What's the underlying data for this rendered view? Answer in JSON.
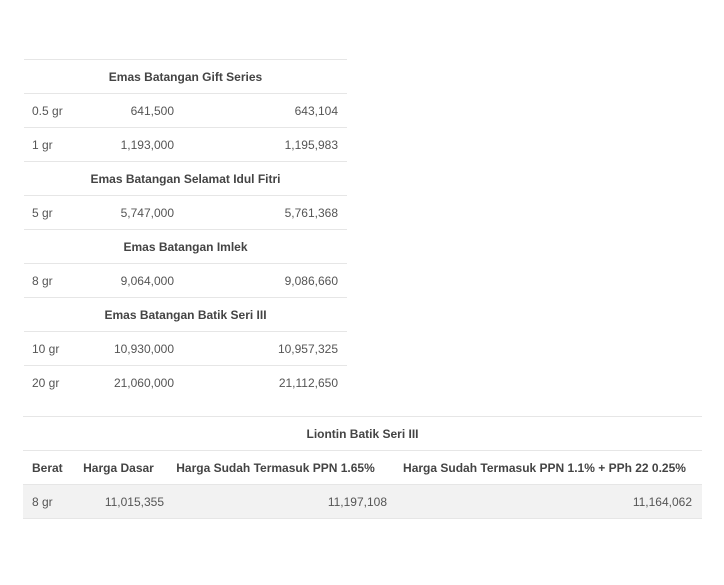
{
  "table1": {
    "sections": [
      {
        "title": "Emas Batangan Gift Series",
        "rows": [
          {
            "berat": "0.5 gr",
            "harga_dasar": "641,500",
            "harga_ppn": "643,104"
          },
          {
            "berat": "1 gr",
            "harga_dasar": "1,193,000",
            "harga_ppn": "1,195,983"
          }
        ]
      },
      {
        "title": "Emas Batangan Selamat Idul Fitri",
        "rows": [
          {
            "berat": "5 gr",
            "harga_dasar": "5,747,000",
            "harga_ppn": "5,761,368"
          }
        ]
      },
      {
        "title": "Emas Batangan Imlek",
        "rows": [
          {
            "berat": "8 gr",
            "harga_dasar": "9,064,000",
            "harga_ppn": "9,086,660"
          }
        ]
      },
      {
        "title": "Emas Batangan Batik Seri III",
        "rows": [
          {
            "berat": "10 gr",
            "harga_dasar": "10,930,000",
            "harga_ppn": "10,957,325"
          },
          {
            "berat": "20 gr",
            "harga_dasar": "21,060,000",
            "harga_ppn": "21,112,650"
          }
        ]
      }
    ]
  },
  "table2": {
    "title": "Liontin Batik Seri III",
    "headers": {
      "berat": "Berat",
      "harga_dasar": "Harga Dasar",
      "harga_ppn1": "Harga Sudah Termasuk PPN 1.65%",
      "harga_ppn2": "Harga Sudah Termasuk PPN 1.1% + PPh 22 0.25%"
    },
    "rows": [
      {
        "berat": "8 gr",
        "harga_dasar": "11,015,355",
        "harga_ppn1": "11,197,108",
        "harga_ppn2": "11,164,062"
      }
    ]
  }
}
